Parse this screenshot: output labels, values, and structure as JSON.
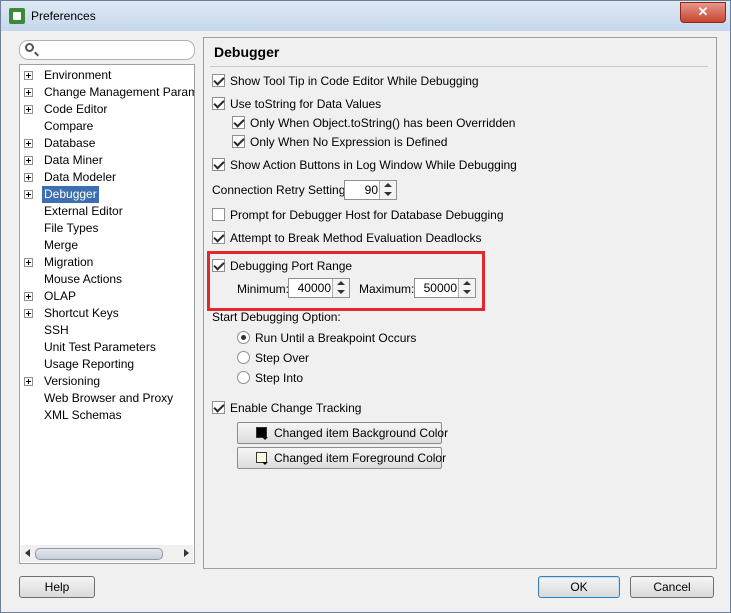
{
  "window": {
    "title": "Preferences",
    "close_glyph": "✕"
  },
  "search": {
    "placeholder": ""
  },
  "tree": {
    "items": [
      {
        "label": "Environment",
        "expandable": true
      },
      {
        "label": "Change Management Paramet",
        "expandable": true
      },
      {
        "label": "Code Editor",
        "expandable": true
      },
      {
        "label": "Compare",
        "expandable": false
      },
      {
        "label": "Database",
        "expandable": true
      },
      {
        "label": "Data Miner",
        "expandable": true
      },
      {
        "label": "Data Modeler",
        "expandable": true
      },
      {
        "label": "Debugger",
        "expandable": true,
        "selected": true
      },
      {
        "label": "External Editor",
        "expandable": false
      },
      {
        "label": "File Types",
        "expandable": false
      },
      {
        "label": "Merge",
        "expandable": false
      },
      {
        "label": "Migration",
        "expandable": true
      },
      {
        "label": "Mouse Actions",
        "expandable": false
      },
      {
        "label": "OLAP",
        "expandable": true
      },
      {
        "label": "Shortcut Keys",
        "expandable": true
      },
      {
        "label": "SSH",
        "expandable": false
      },
      {
        "label": "Unit Test Parameters",
        "expandable": false
      },
      {
        "label": "Usage Reporting",
        "expandable": false
      },
      {
        "label": "Versioning",
        "expandable": true
      },
      {
        "label": "Web Browser and Proxy",
        "expandable": false
      },
      {
        "label": "XML Schemas",
        "expandable": false
      }
    ]
  },
  "debugger": {
    "title": "Debugger",
    "show_tooltip": {
      "label": "Show Tool Tip in Code Editor While Debugging",
      "checked": true
    },
    "use_tostring": {
      "label": "Use toString for Data Values",
      "checked": true
    },
    "only_overridden": {
      "label": "Only When Object.toString() has been Overridden",
      "checked": true
    },
    "only_no_expression": {
      "label": "Only When No Expression is Defined",
      "checked": true
    },
    "show_action_buttons": {
      "label": "Show Action Buttons in Log Window While Debugging",
      "checked": true
    },
    "connection_retry": {
      "label": "Connection Retry Setting:",
      "value": "90"
    },
    "prompt_host": {
      "label": "Prompt for Debugger Host for Database Debugging",
      "checked": false
    },
    "break_deadlocks": {
      "label": "Attempt to Break Method Evaluation Deadlocks",
      "checked": true
    },
    "port_range": {
      "label": "Debugging Port Range",
      "checked": true,
      "min_label": "Minimum:",
      "min_value": "40000",
      "max_label": "Maximum:",
      "max_value": "50000",
      "highlight_color": "#e2282f"
    },
    "start_option": {
      "label": "Start Debugging Option:",
      "options": [
        {
          "label": "Run Until a Breakpoint Occurs",
          "selected": true
        },
        {
          "label": "Step Over",
          "selected": false
        },
        {
          "label": "Step Into",
          "selected": false
        }
      ]
    },
    "change_tracking": {
      "label": "Enable Change Tracking",
      "checked": true
    },
    "bg_color_button": {
      "label": "Changed item Background Color",
      "swatch": "#000000"
    },
    "fg_color_button": {
      "label": "Changed item Foreground Color",
      "swatch": "#ffffe0"
    }
  },
  "footer": {
    "help": "Help",
    "ok": "OK",
    "cancel": "Cancel"
  }
}
